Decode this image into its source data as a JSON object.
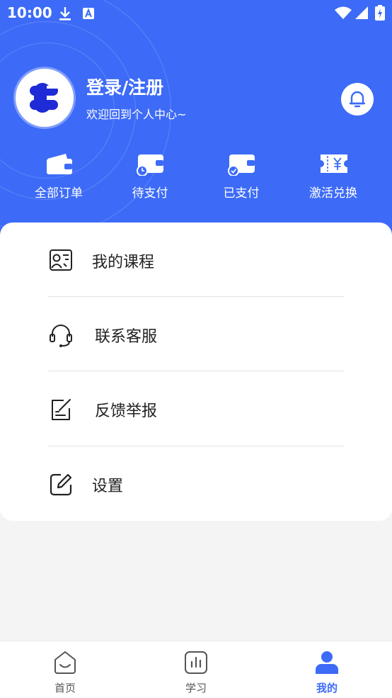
{
  "status_bar": {
    "time": "10:00"
  },
  "profile": {
    "login_text": "登录/注册",
    "welcome_text": "欢迎回到个人中心~"
  },
  "orders": [
    {
      "label": "全部订单",
      "icon": "wallet-icon"
    },
    {
      "label": "待支付",
      "icon": "wallet-clock-icon"
    },
    {
      "label": "已支付",
      "icon": "wallet-check-icon"
    },
    {
      "label": "激活兑换",
      "icon": "ticket-yen-icon"
    }
  ],
  "menu": [
    {
      "label": "我的课程",
      "icon": "course-icon"
    },
    {
      "label": "联系客服",
      "icon": "headset-icon"
    },
    {
      "label": "反馈举报",
      "icon": "feedback-icon"
    },
    {
      "label": "设置",
      "icon": "edit-settings-icon"
    }
  ],
  "tabs": [
    {
      "label": "首页",
      "icon": "home-icon",
      "active": false
    },
    {
      "label": "学习",
      "icon": "study-chart-icon",
      "active": false
    },
    {
      "label": "我的",
      "icon": "user-icon",
      "active": true
    }
  ],
  "colors": {
    "primary": "#3d6bf7",
    "background": "#f4f4f4"
  }
}
